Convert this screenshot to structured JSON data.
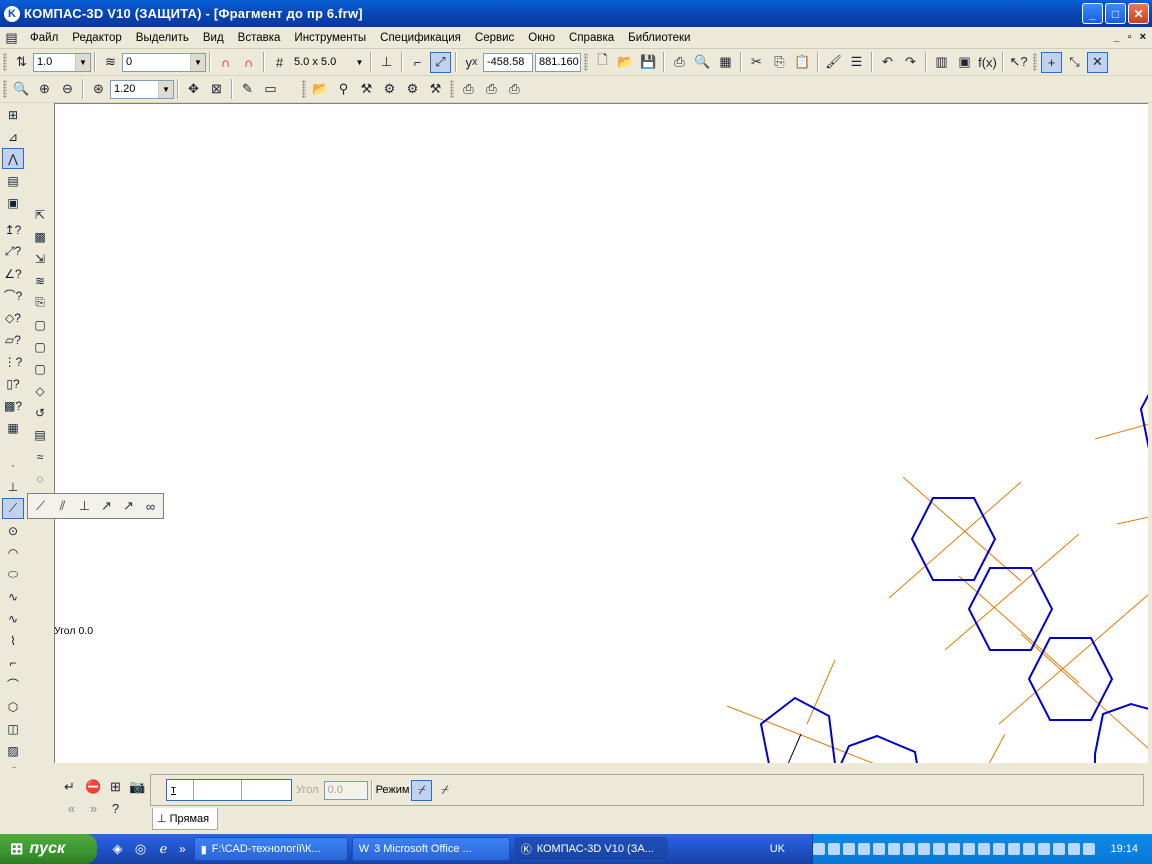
{
  "titlebar": {
    "title": "КОМПАС-3D V10 (ЗАЩИТА) - [Фрагмент до пр 6.frw]",
    "min": "_",
    "max": "□",
    "close": "✕"
  },
  "menu": [
    "Файл",
    "Редактор",
    "Выделить",
    "Вид",
    "Вставка",
    "Инструменты",
    "Спецификация",
    "Сервис",
    "Окно",
    "Справка",
    "Библиотеки"
  ],
  "toolbar1": {
    "step": "1.0",
    "layer": "0",
    "grid": "5.0 x 5.0",
    "coord_x": "-458.58",
    "coord_y": "881.160"
  },
  "toolbar2": {
    "zoom": "1.20"
  },
  "canvas": {
    "angle_label": "Угол 0.0"
  },
  "properties": {
    "angle_label": "Угол",
    "angle_value": "0.0",
    "mode_label": "Режим",
    "tab_label": "Прямая",
    "t_label": "т"
  },
  "taskbar": {
    "start": "пуск",
    "tasks": [
      "F:\\CAD-технології\\К...",
      "3 Microsoft Office ...",
      "КОМПАС-3D V10 (ЗА..."
    ],
    "lang": "UK",
    "time": "19:14"
  },
  "colors": {
    "hex_line": "#0000cc",
    "axis_line": "#e07b00",
    "title_blue": "#0842b0"
  }
}
